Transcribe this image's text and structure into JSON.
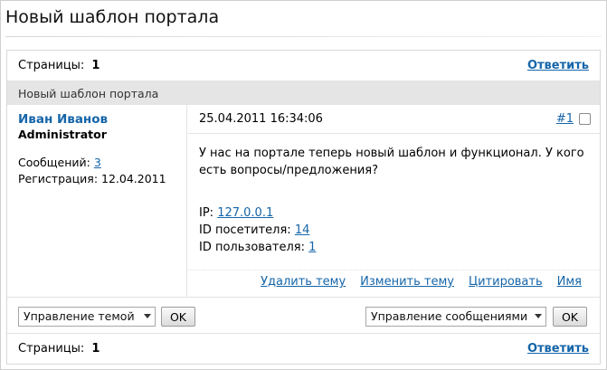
{
  "page_title": "Новый шаблон портала",
  "pages_label": "Страницы:",
  "pages_value": "1",
  "reply_label": "Ответить",
  "topic_title": "Новый шаблон портала",
  "post": {
    "author_name": "Иван Иванов",
    "author_role": "Administrator",
    "messages_label": "Сообщений:",
    "messages_count": "3",
    "registration_label": "Регистрация:",
    "registration_date": "12.04.2011",
    "datetime": "25.04.2011 16:34:06",
    "post_number": "#1",
    "text": "У нас на портале теперь новый шаблон и функционал. У кого есть вопросы/предложения?",
    "ip_label": "IP:",
    "ip_value": "127.0.0.1",
    "visitor_label": "ID посетителя:",
    "visitor_id": "14",
    "user_label": "ID пользователя:",
    "user_id": "1"
  },
  "post_actions": {
    "delete": "Удалить тему",
    "edit": "Изменить тему",
    "quote": "Цитировать",
    "name": "Имя"
  },
  "controls": {
    "topic_select": "Управление темой",
    "ok": "OK",
    "messages_select": "Управление сообщениями"
  },
  "colors": {
    "link": "#1565a9",
    "topic_header_bg": "#e5e5e5"
  }
}
